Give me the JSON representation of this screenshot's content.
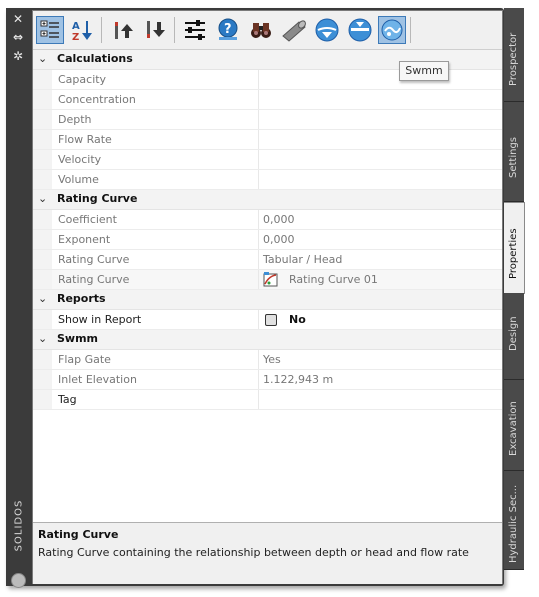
{
  "palette": {
    "name": "SOLIDOS"
  },
  "toolbar": {
    "buttons": [
      {
        "icon": "categorized-view-icon"
      },
      {
        "icon": "sort-alphabetical-icon"
      },
      {
        "icon": "move-up-icon"
      },
      {
        "icon": "move-down-icon"
      },
      {
        "icon": "settings-sliders-icon"
      },
      {
        "icon": "query-icon"
      },
      {
        "icon": "binoculars-icon"
      },
      {
        "icon": "pipe-icon"
      },
      {
        "icon": "inlet-icon"
      },
      {
        "icon": "water-level-icon"
      },
      {
        "icon": "swmm-icon"
      }
    ],
    "tooltip": "Swmm"
  },
  "categories": [
    {
      "name": "Calculations",
      "rows": [
        {
          "label": "Capacity",
          "value": ""
        },
        {
          "label": "Concentration",
          "value": ""
        },
        {
          "label": "Depth",
          "value": ""
        },
        {
          "label": "Flow Rate",
          "value": ""
        },
        {
          "label": "Velocity",
          "value": ""
        },
        {
          "label": "Volume",
          "value": ""
        }
      ]
    },
    {
      "name": "Rating Curve",
      "rows": [
        {
          "label": "Coefficient",
          "value": "0,000"
        },
        {
          "label": "Exponent",
          "value": "0,000"
        },
        {
          "label": "Rating Curve",
          "value": "Tabular / Head"
        },
        {
          "label": "Rating Curve",
          "value": "Rating Curve 01"
        }
      ]
    },
    {
      "name": "Reports",
      "rows": [
        {
          "label": "Show in Report",
          "value": "No"
        }
      ]
    },
    {
      "name": "Swmm",
      "rows": [
        {
          "label": "Flap Gate",
          "value": "Yes"
        },
        {
          "label": "Inlet Elevation",
          "value": "1.122,943 m"
        },
        {
          "label": "Tag",
          "value": ""
        }
      ]
    }
  ],
  "description": {
    "title": "Rating Curve",
    "text": "Rating Curve containing the relationship between depth or head and flow rate"
  },
  "tabs": [
    {
      "label": "Prospector"
    },
    {
      "label": "Settings"
    },
    {
      "label": "Properties"
    },
    {
      "label": "Design"
    },
    {
      "label": "Excavation"
    },
    {
      "label": "Hydraulic Sec..."
    }
  ]
}
